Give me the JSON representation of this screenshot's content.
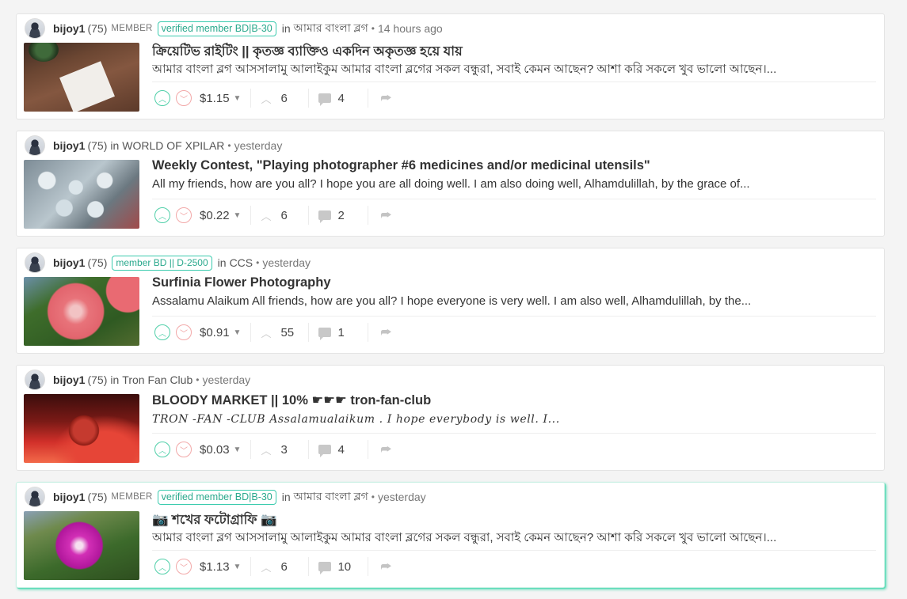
{
  "posts": [
    {
      "author": "bijoy1",
      "reputation": "(75)",
      "role": "MEMBER",
      "badge": "verified member BD|B-30",
      "in_label": "in",
      "community": "আমার বাংলা ব্লগ",
      "time": "14 hours ago",
      "title": "ক্রিয়েটিভ রাইটিং || কৃতজ্ঞ ব্যাক্তিও একদিন অকৃতজ্ঞ হয়ে যায়",
      "summary": "আমার বাংলা ব্লগ আসসালামু আলাইকুম আমার বাংলা ব্লগের সকল বন্ধুরা, সবাই কেমন আছেন? আশা করি সকলে খুব ভালো আছেন।...",
      "payout": "$1.15",
      "votes": "6",
      "comments": "4",
      "thumb_icon": "thank-you-note-photo-icon"
    },
    {
      "author": "bijoy1",
      "reputation": "(75)",
      "role": "",
      "badge": "",
      "in_label": "in",
      "community": "WORLD OF XPILAR",
      "time": "yesterday",
      "title": "Weekly Contest, \"Playing photographer #6 medicines and/or medicinal utensils\"",
      "summary": "All my friends, how are you all? I hope you are all doing well. I am also doing well, Alhamdulillah, by the grace of...",
      "payout": "$0.22",
      "votes": "6",
      "comments": "2",
      "thumb_icon": "medicine-blister-photo-icon"
    },
    {
      "author": "bijoy1",
      "reputation": "(75)",
      "role": "",
      "badge": "member BD || D-2500",
      "in_label": "in",
      "community": "CCS",
      "time": "yesterday",
      "title": "Surfinia Flower Photography",
      "summary": "Assalamu Alaikum All friends, how are you all? I hope everyone is very well. I am also well, Alhamdulillah, by the...",
      "payout": "$0.91",
      "votes": "55",
      "comments": "1",
      "thumb_icon": "pink-flower-photo-icon"
    },
    {
      "author": "bijoy1",
      "reputation": "(75)",
      "role": "",
      "badge": "",
      "in_label": "in",
      "community": "Tron Fan Club",
      "time": "yesterday",
      "title": "BLOODY MARKET || 10% ☛☛☛ tron-fan-club",
      "summary": "TRON -FAN -CLUB Assalamualaikum . I hope everybody is well. I...",
      "payout": "$0.03",
      "votes": "3",
      "comments": "4",
      "thumb_icon": "bitcoin-red-photo-icon"
    },
    {
      "author": "bijoy1",
      "reputation": "(75)",
      "role": "MEMBER",
      "badge": "verified member BD|B-30",
      "in_label": "in",
      "community": "আমার বাংলা ব্লগ",
      "time": "yesterday",
      "title": "📷 শখের ফটোগ্রাফি 📷",
      "summary": "আমার বাংলা ব্লগ আসসালামু আলাইকুম আমার বাংলা ব্লগের সকল বন্ধুরা, সবাই কেমন আছেন? আশা করি সকলে খুব ভালো আছেন।...",
      "payout": "$1.13",
      "votes": "6",
      "comments": "10",
      "thumb_icon": "magenta-flower-photo-icon"
    }
  ],
  "colors": {
    "upvote": "#4fcfa8",
    "downvote": "#f09c9c",
    "badge_border": "#3bcbae",
    "highlight": "#5ddcb8"
  }
}
